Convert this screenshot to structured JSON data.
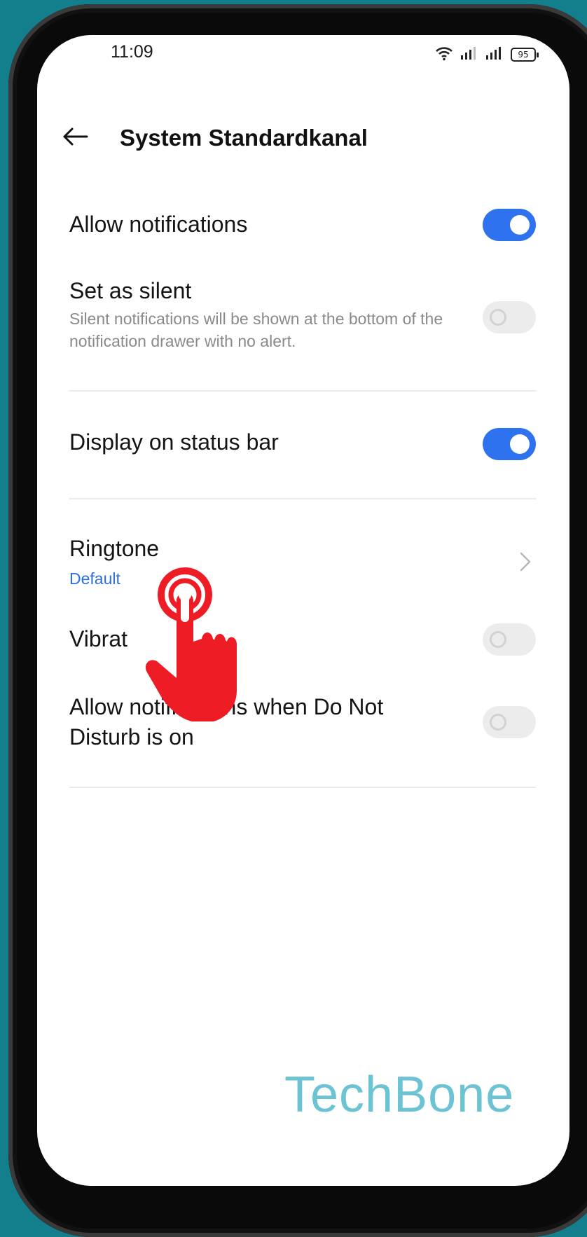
{
  "status_bar": {
    "time": "11:09",
    "battery": "95"
  },
  "header": {
    "title": "System Standardkanal"
  },
  "settings": {
    "allow_notifications": {
      "label": "Allow notifications",
      "enabled": true
    },
    "set_as_silent": {
      "label": "Set as silent",
      "description": "Silent notifications will be shown at the bottom of the notification drawer with no alert.",
      "enabled": false
    },
    "display_on_status_bar": {
      "label": "Display on status bar",
      "enabled": true
    },
    "ringtone": {
      "label": "Ringtone",
      "value": "Default"
    },
    "vibration": {
      "label": "Vibrat",
      "enabled": false
    },
    "allow_dnd": {
      "label": "Allow notifications when Do Not Disturb is on",
      "enabled": false
    }
  },
  "watermark": "TechBone",
  "colors": {
    "accent": "#2f72f0",
    "background": "#137e8c",
    "watermark": "#6cc3d3",
    "tap_hand": "#ee1c25"
  },
  "icons": {
    "back": "back-arrow-icon",
    "chevron": "chevron-right-icon",
    "wifi": "wifi-icon",
    "signal": "signal-icon",
    "battery": "battery-icon",
    "tap": "tap-hand-icon"
  }
}
